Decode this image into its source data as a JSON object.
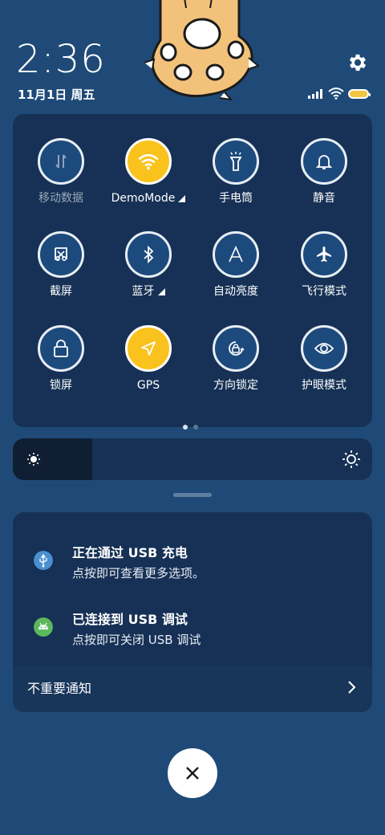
{
  "status": {
    "time": "2:36",
    "date": "11月1日 周五",
    "battery_color": "#f4c542"
  },
  "icons": {
    "settings": "gear-icon",
    "signal": "signal-icon",
    "wifi": "wifi-icon",
    "battery": "battery-icon",
    "decoration": "cat-paw-icon"
  },
  "quick_settings": {
    "tiles": [
      {
        "label": "移动数据",
        "icon": "mobile-data-icon",
        "active": false,
        "disabled": true
      },
      {
        "label": "DemoMode",
        "icon": "wifi-icon",
        "active": true,
        "expandable": true
      },
      {
        "label": "手电筒",
        "icon": "flashlight-icon",
        "active": false
      },
      {
        "label": "静音",
        "icon": "bell-icon",
        "active": false
      },
      {
        "label": "截屏",
        "icon": "screenshot-icon",
        "active": false
      },
      {
        "label": "蓝牙",
        "icon": "bluetooth-icon",
        "active": false,
        "expandable": true
      },
      {
        "label": "自动亮度",
        "icon": "auto-brightness-icon",
        "active": false
      },
      {
        "label": "飞行模式",
        "icon": "airplane-icon",
        "active": false
      },
      {
        "label": "锁屏",
        "icon": "lock-icon",
        "active": false
      },
      {
        "label": "GPS",
        "icon": "gps-icon",
        "active": true
      },
      {
        "label": "方向锁定",
        "icon": "rotation-lock-icon",
        "active": false
      },
      {
        "label": "护眼模式",
        "icon": "eye-icon",
        "active": false
      }
    ],
    "page_count": 2,
    "current_page": 1,
    "active_color": "#f9c21d"
  },
  "brightness": {
    "level": 0.22,
    "low_icon": "sun-small-icon",
    "high_icon": "sun-large-icon"
  },
  "notifications": {
    "items": [
      {
        "title": "正在通过 USB 充电",
        "text": "点按即可查看更多选项。",
        "icon": "usb-icon",
        "icon_color": "#4a8fd1"
      },
      {
        "title": "已连接到 USB 调试",
        "text": "点按即可关闭 USB 调试",
        "icon": "android-debug-icon",
        "icon_color": "#5cb85c"
      }
    ],
    "minor_label": "不重要通知"
  },
  "close_icon": "close-icon"
}
